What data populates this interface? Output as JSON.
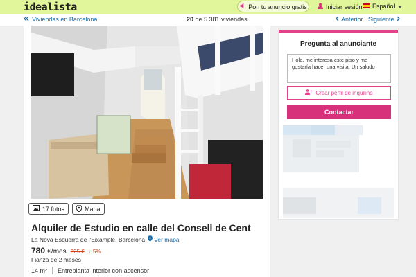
{
  "header": {
    "logo": "idealista",
    "post_ad_label": "Pon tu anuncio gratis",
    "login_label": "Iniciar sesión",
    "language_label": "Español",
    "brand_color": "#e1f59a"
  },
  "nav": {
    "back_label": "Viviendas en Barcelona",
    "counter_current": "20",
    "counter_text": "de 5.381 viviendas",
    "prev_label": "Anterior",
    "next_label": "Siguiente"
  },
  "listing": {
    "photos_label": "17 fotos",
    "map_label": "Mapa",
    "title": "Alquiler de Estudio en calle del Consell de Cent",
    "location": "La Nova Esquerra de l'Eixample, Barcelona",
    "map_link": "Ver mapa",
    "price": "780",
    "price_unit": "€/mes",
    "old_price": "825 €",
    "discount": "5%",
    "deposit": "Fianza de 2 meses",
    "area": "14 m²",
    "floor": "Entreplanta interior con ascensor"
  },
  "contact": {
    "title": "Pregunta al anunciante",
    "message": "Hola, me interesa este piso y me gustaría hacer una visita. Un saludo",
    "profile_button": "Crear perfil de inquilino",
    "contact_button": "Contactar",
    "accent_color": "#d8317c"
  },
  "icons": [
    "megaphone-icon",
    "user-icon",
    "flag-icon",
    "chevron-left-icon",
    "chevron-right-icon",
    "image-icon",
    "map-pin-icon",
    "arrow-down-icon",
    "user-plus-icon"
  ]
}
